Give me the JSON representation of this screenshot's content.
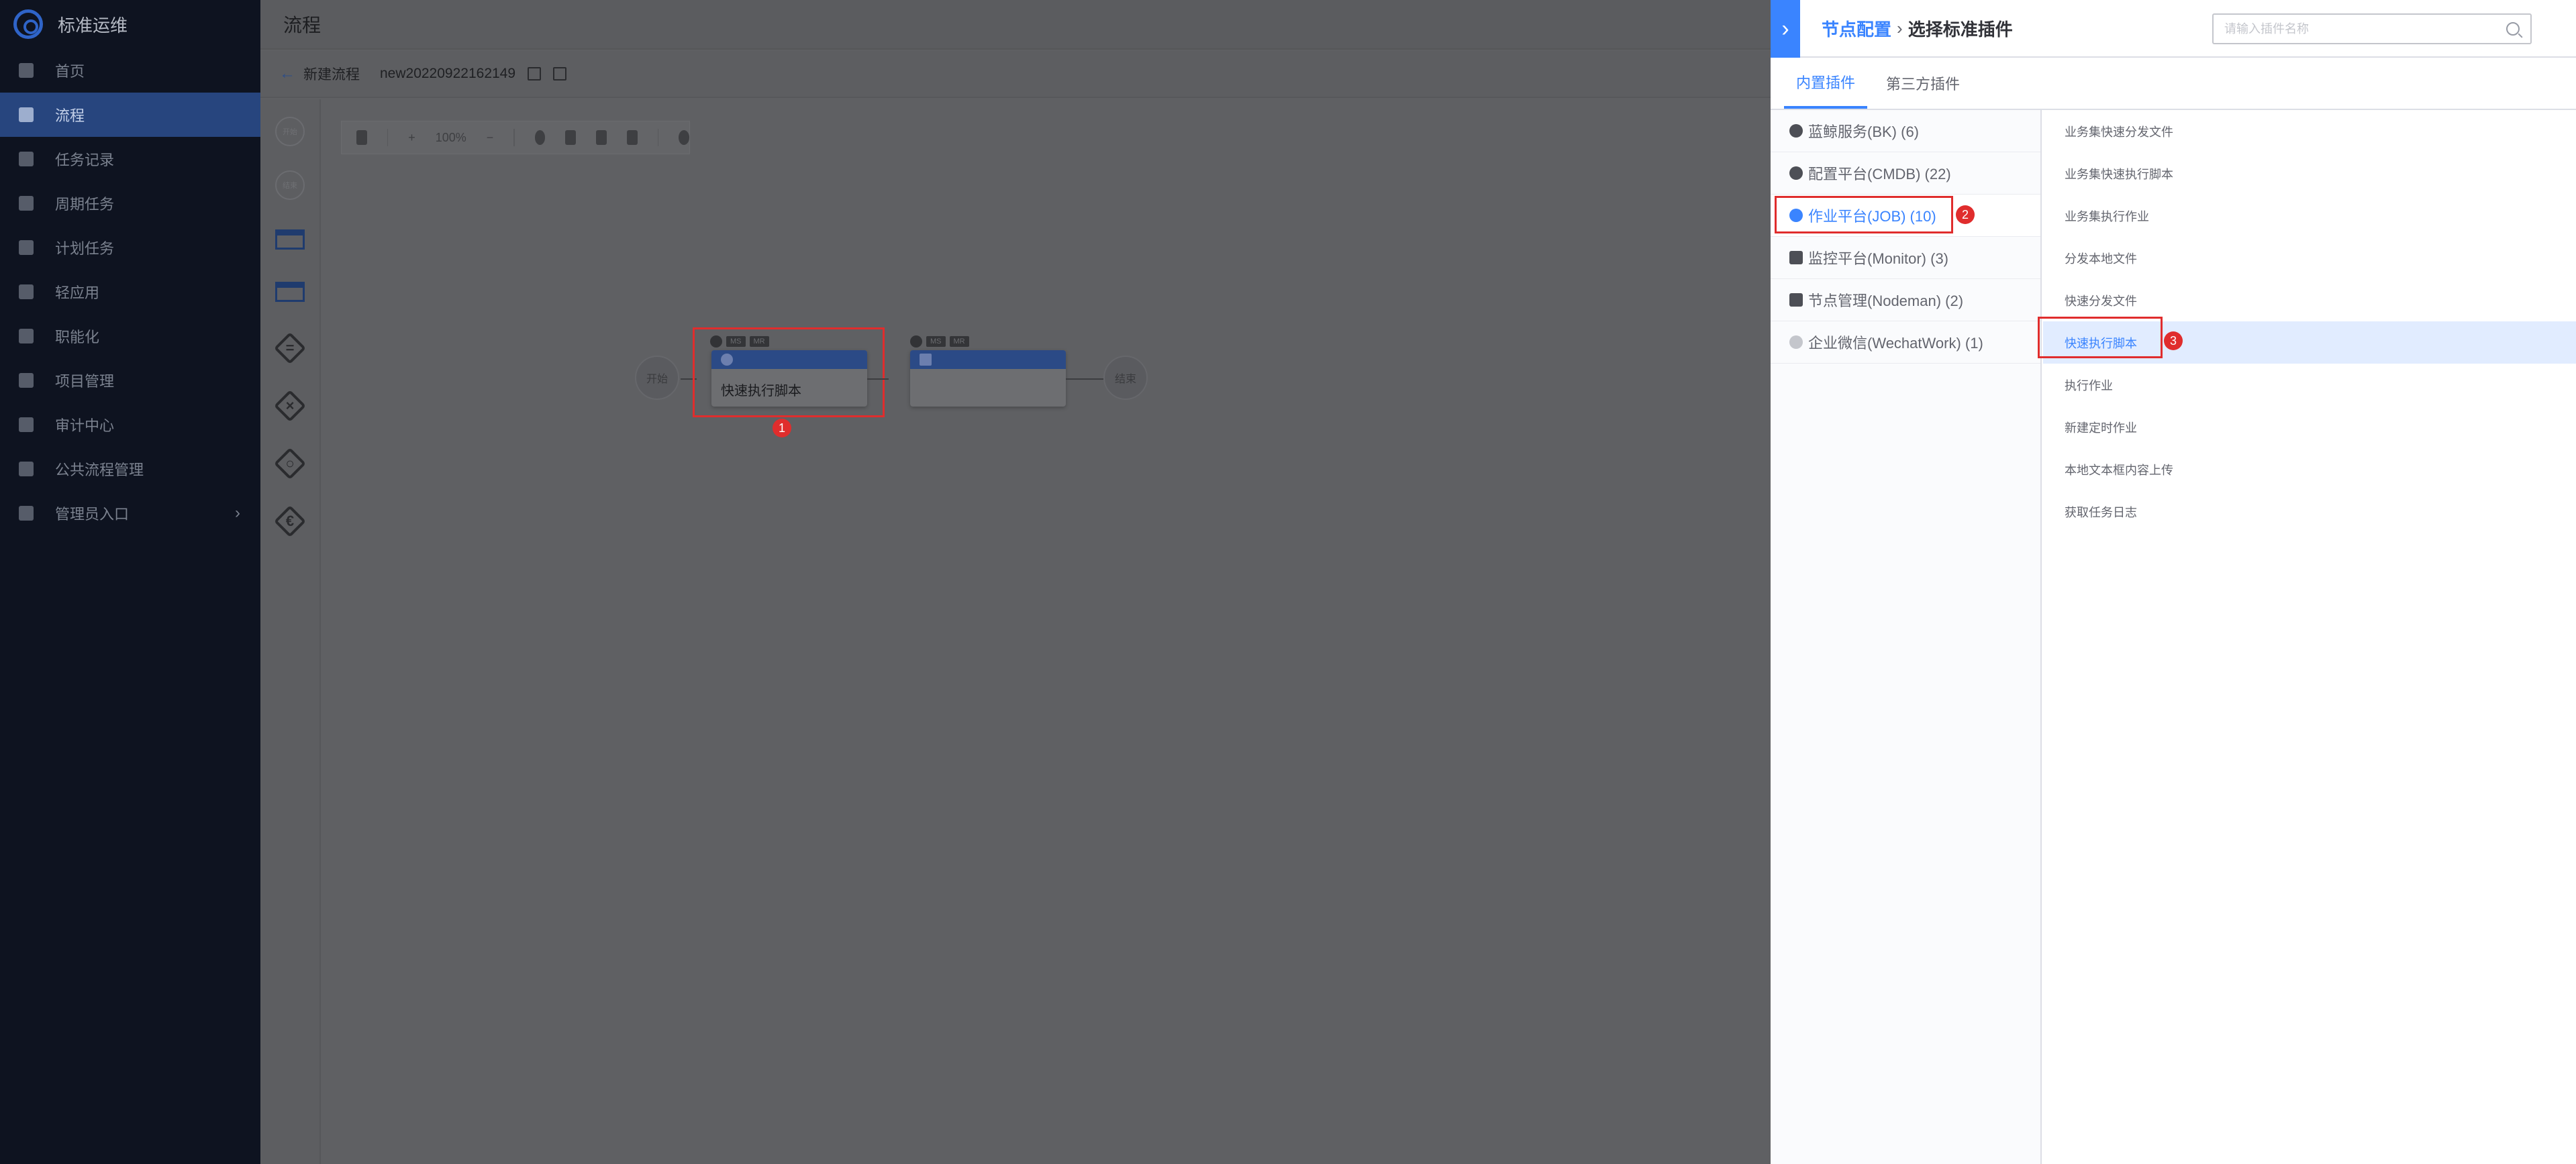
{
  "app": {
    "brand": "标准运维"
  },
  "nav": {
    "items": [
      {
        "label": "首页",
        "icon": "home-icon"
      },
      {
        "label": "流程",
        "icon": "flow-icon",
        "active": true
      },
      {
        "label": "任务记录",
        "icon": "task-record-icon"
      },
      {
        "label": "周期任务",
        "icon": "periodic-task-icon"
      },
      {
        "label": "计划任务",
        "icon": "plan-task-icon"
      },
      {
        "label": "轻应用",
        "icon": "mini-app-icon"
      },
      {
        "label": "职能化",
        "icon": "function-icon"
      },
      {
        "label": "项目管理",
        "icon": "project-icon"
      },
      {
        "label": "审计中心",
        "icon": "audit-icon"
      },
      {
        "label": "公共流程管理",
        "icon": "public-flow-icon"
      },
      {
        "label": "管理员入口",
        "icon": "admin-icon",
        "chevron": "›"
      }
    ]
  },
  "header": {
    "title": "流程"
  },
  "subbar": {
    "back_label": "新建流程",
    "flow_name": "new20220922162149"
  },
  "palette": {
    "start": "开始",
    "end": "结束"
  },
  "toolbar": {
    "zoom": "100%"
  },
  "canvas": {
    "start_label": "开始",
    "end_label": "结束",
    "node1": {
      "label": "快速执行脚本",
      "tags": [
        "MS",
        "MR"
      ]
    },
    "node2": {
      "label": "",
      "tags": [
        "MS",
        "MR"
      ]
    }
  },
  "annotations": {
    "badge1": "1",
    "badge2": "2",
    "badge3": "3",
    "color": "#e02d2d"
  },
  "drawer": {
    "breadcrumb_root": "节点配置",
    "breadcrumb_sep": "›",
    "breadcrumb_current": "选择标准插件",
    "search_placeholder": "请输入插件名称",
    "tabs": [
      {
        "label": "内置插件",
        "active": true
      },
      {
        "label": "第三方插件"
      }
    ],
    "categories": [
      {
        "label": "蓝鲸服务(BK) (6)"
      },
      {
        "label": "配置平台(CMDB) (22)"
      },
      {
        "label": "作业平台(JOB) (10)",
        "active": true
      },
      {
        "label": "监控平台(Monitor) (3)"
      },
      {
        "label": "节点管理(Nodeman) (2)"
      },
      {
        "label": "企业微信(WechatWork) (1)"
      }
    ],
    "plugins": [
      {
        "label": "业务集快速分发文件"
      },
      {
        "label": "业务集快速执行脚本"
      },
      {
        "label": "业务集执行作业"
      },
      {
        "label": "分发本地文件"
      },
      {
        "label": "快速分发文件"
      },
      {
        "label": "快速执行脚本",
        "active": true
      },
      {
        "label": "执行作业"
      },
      {
        "label": "新建定时作业"
      },
      {
        "label": "本地文本框内容上传"
      },
      {
        "label": "获取任务日志"
      }
    ]
  },
  "colors": {
    "accent": "#3a84ff",
    "nav_active": "#27457e",
    "annotation": "#e02d2d"
  }
}
